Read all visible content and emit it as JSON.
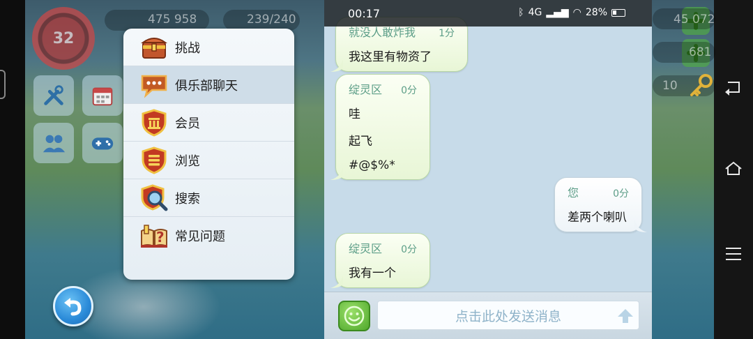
{
  "status_bar": {
    "time": "00:17",
    "network": "4G",
    "battery": "28%"
  },
  "hud": {
    "level": "32",
    "population": "475 958",
    "capacity": "239/240",
    "gold_partial": "45 072",
    "diamond": "681",
    "keys": "10"
  },
  "menu": {
    "items": [
      {
        "label": "挑战",
        "icon": "treasure-chest-icon",
        "active": false
      },
      {
        "label": "俱乐部聊天",
        "icon": "chat-bubble-icon",
        "active": true
      },
      {
        "label": "会员",
        "icon": "member-shield-icon",
        "active": false
      },
      {
        "label": "浏览",
        "icon": "browse-shield-icon",
        "active": false
      },
      {
        "label": "搜索",
        "icon": "search-shield-icon",
        "active": false
      },
      {
        "label": "常见问题",
        "icon": "faq-book-icon",
        "active": false
      }
    ]
  },
  "chat": {
    "messages": [
      {
        "sender": "就没人敢炸我",
        "time": "1分",
        "lines": [
          "我这里有物资了"
        ],
        "mine": false
      },
      {
        "sender": "绽灵区",
        "time": "0分",
        "lines": [
          "哇",
          "起飞",
          "#@$%*"
        ],
        "mine": false
      },
      {
        "sender": "您",
        "time": "0分",
        "lines": [
          "差两个喇叭"
        ],
        "mine": true
      },
      {
        "sender": "绽灵区",
        "time": "0分",
        "lines": [
          "我有一个"
        ],
        "mine": false
      }
    ],
    "input_placeholder": "点击此处发送消息"
  },
  "colors": {
    "bubble_green": "#e8f6d6",
    "sender_teal": "#5d9e88",
    "chat_bg": "#c7dbe9",
    "menu_bg": "#f4f8fb"
  }
}
